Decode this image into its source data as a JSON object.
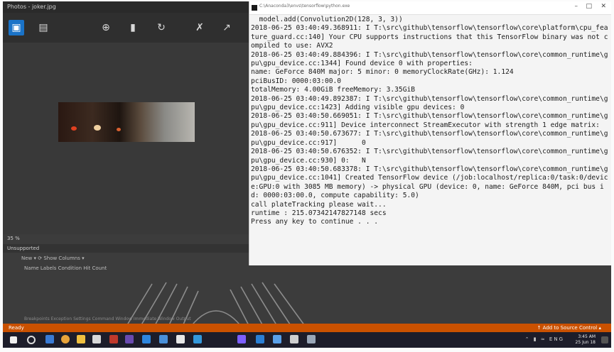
{
  "viewer": {
    "title": "Photos - joker.jpg",
    "toolbar_icons": [
      "image-icon",
      "slideshow-icon",
      "zoom-icon",
      "delete-icon",
      "rotate-icon",
      "crop-icon",
      "edit-icon"
    ]
  },
  "panel": {
    "zoom": "35 %",
    "header": "Unsupported",
    "toolbar": "New ▾     ⟳          Show Columns ▾",
    "columns": "Name   Labels   Condition   Hit Count",
    "tabs": "Breakpoints    Exception Settings    Command Window    Immediate Window    Output"
  },
  "statusbar": {
    "ready": "Ready",
    "source_control": "↑ Add to Source Control ▴"
  },
  "tray": {
    "time": "3:45 AM",
    "date": "25 Jun 18",
    "lang": "ENG"
  },
  "console": {
    "title": "C:\\Anaconda3\\envs\\tensorflow\\python.exe",
    "lines": [
      "  model.add(Convolution2D(128, 3, 3))",
      "2018-06-25 03:40:49.368911: I T:\\src\\github\\tensorflow\\tensorflow\\core\\platform\\cpu_feature_guard.cc:140] Your CPU supports instructions that this TensorFlow binary was not compiled to use: AVX2",
      "2018-06-25 03:40:49.884396: I T:\\src\\github\\tensorflow\\tensorflow\\core\\common_runtime\\gpu\\gpu_device.cc:1344] Found device 0 with properties:",
      "name: GeForce 840M major: 5 minor: 0 memoryClockRate(GHz): 1.124",
      "pciBusID: 0000:03:00.0",
      "totalMemory: 4.00GiB freeMemory: 3.35GiB",
      "2018-06-25 03:40:49.892387: I T:\\src\\github\\tensorflow\\tensorflow\\core\\common_runtime\\gpu\\gpu_device.cc:1423] Adding visible gpu devices: 0",
      "2018-06-25 03:40:50.669051: I T:\\src\\github\\tensorflow\\tensorflow\\core\\common_runtime\\gpu\\gpu_device.cc:911] Device interconnect StreamExecutor with strength 1 edge matrix:",
      "2018-06-25 03:40:50.673677: I T:\\src\\github\\tensorflow\\tensorflow\\core\\common_runtime\\gpu\\gpu_device.cc:917]      0",
      "2018-06-25 03:40:50.676352: I T:\\src\\github\\tensorflow\\tensorflow\\core\\common_runtime\\gpu\\gpu_device.cc:930] 0:   N",
      "2018-06-25 03:40:50.683378: I T:\\src\\github\\tensorflow\\tensorflow\\core\\common_runtime\\gpu\\gpu_device.cc:1041] Created TensorFlow device (/job:localhost/replica:0/task:0/device:GPU:0 with 3085 MB memory) -> physical GPU (device: 0, name: GeForce 840M, pci bus id: 0000:03:00.0, compute capability: 5.0)",
      "call plateTracking please wait...",
      "runtime : 215.07342147827148 secs",
      "Press any key to continue . . ."
    ]
  },
  "colors": {
    "accent": "#1a73c8",
    "statusbar": "#ca5100",
    "taskbar": "#1d1d2a"
  }
}
